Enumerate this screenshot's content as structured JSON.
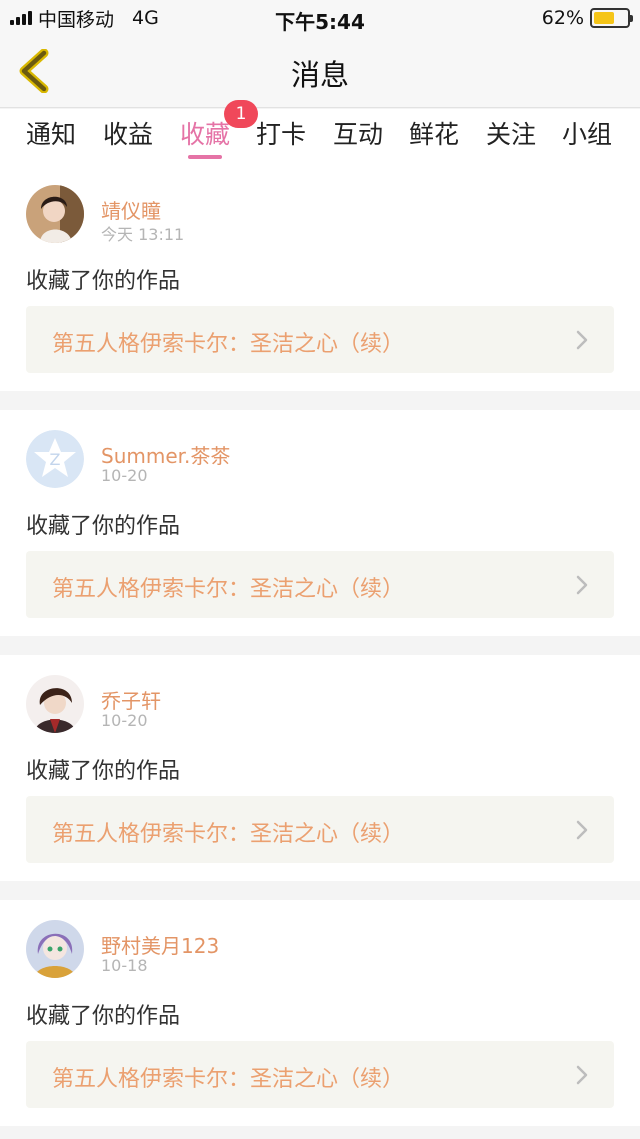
{
  "status_bar": {
    "carrier": "中国移动",
    "network": "4G",
    "time": "下午5:44",
    "battery_percent": "62%",
    "battery_level": 0.62
  },
  "nav": {
    "title": "消息",
    "back_icon": "chevron-left-icon"
  },
  "tabs": {
    "items": [
      {
        "label": "通知"
      },
      {
        "label": "收益"
      },
      {
        "label": "收藏",
        "active": true,
        "badge": "1"
      },
      {
        "label": "打卡"
      },
      {
        "label": "互动"
      },
      {
        "label": "鲜花"
      },
      {
        "label": "关注"
      },
      {
        "label": "小组"
      }
    ]
  },
  "colors": {
    "accent": "#e573a6",
    "badge": "#f0485a",
    "username": "#e39566",
    "work_title": "#eba070"
  },
  "feed": {
    "items": [
      {
        "username": "靖仪瞳",
        "time": "今天 13:11",
        "action": "收藏了你的作品",
        "work_title": "第五人格伊索卡尔：圣洁之心（续）"
      },
      {
        "username": "Summer.茶茶",
        "time": "10-20",
        "action": "收藏了你的作品",
        "work_title": "第五人格伊索卡尔：圣洁之心（续）"
      },
      {
        "username": "乔子轩",
        "time": "10-20",
        "action": "收藏了你的作品",
        "work_title": "第五人格伊索卡尔：圣洁之心（续）"
      },
      {
        "username": "野村美月123",
        "time": "10-18",
        "action": "收藏了你的作品",
        "work_title": "第五人格伊索卡尔：圣洁之心（续）"
      }
    ]
  }
}
